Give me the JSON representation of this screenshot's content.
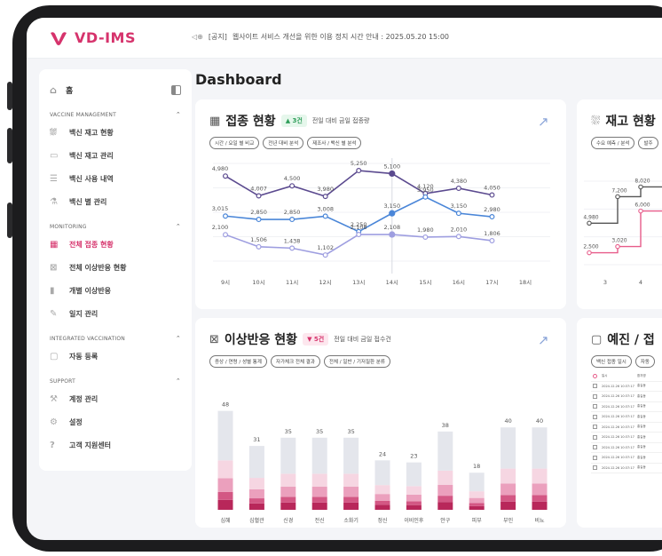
{
  "app": {
    "brand": "VD-IMS"
  },
  "notice": {
    "tag": "[공지]",
    "text": "웹사이트 서비스 개선을 위한 이용 정지 시간 안내 : 2025.05.20 15:00"
  },
  "sidebar": {
    "home": "홈",
    "sections": [
      {
        "title": "VACCINE MANAGEMENT",
        "items": [
          {
            "label": "백신 재고 현황",
            "icon": "chart-area-icon"
          },
          {
            "label": "백신 재고 관리",
            "icon": "box-icon"
          },
          {
            "label": "백신 사용 내역",
            "icon": "list-icon"
          },
          {
            "label": "백신 별 관리",
            "icon": "vial-icon"
          }
        ]
      },
      {
        "title": "MONITORING",
        "items": [
          {
            "label": "전체 접종 현황",
            "icon": "chart-box-icon",
            "active": true
          },
          {
            "label": "전체 이상반응 현황",
            "icon": "alert-chart-icon"
          },
          {
            "label": "개별 이상반응",
            "icon": "bar-icon"
          },
          {
            "label": "일지 관리",
            "icon": "edit-icon"
          }
        ]
      },
      {
        "title": "INTEGRATED VACCINATION",
        "items": [
          {
            "label": "자동 등록",
            "icon": "calendar-icon"
          }
        ]
      },
      {
        "title": "SUPPORT",
        "items": [
          {
            "label": "계정 관리",
            "icon": "wrench-icon"
          },
          {
            "label": "설정",
            "icon": "gear-icon"
          },
          {
            "label": "고객 지원센터",
            "icon": "help-icon"
          }
        ]
      }
    ]
  },
  "page": {
    "title": "Dashboard"
  },
  "cards": {
    "vaccination": {
      "title": "접종 현황",
      "badge": "▲ 3건",
      "subtitle": "전일 대비 금일 접종량",
      "chips": [
        "시간 / 요일 별 비교",
        "전년 대비 분석",
        "제조사 / 백신 별 분석"
      ]
    },
    "stock": {
      "title": "재고 현황",
      "chips": [
        "수요 예측 / 분석",
        "발주"
      ]
    },
    "adverse": {
      "title": "이상반응 현황",
      "badge": "▼ 5건",
      "subtitle": "전일 대비 금일 접수건",
      "chips": [
        "증상 / 연령 / 성별 통계",
        "자가체크 전체 결과",
        "전체 / 일반 / 기저질환 분류"
      ]
    },
    "reservation": {
      "title": "예진 / 접",
      "chips": [
        "백신 접종 일시",
        "자동"
      ],
      "table_headers": [
        "일시",
        "환자명"
      ],
      "rows": [
        [
          "2024.12.26 10:37:17",
          "홍길동"
        ],
        [
          "2024.12.26 10:37:17",
          "홍길동"
        ],
        [
          "2024.12.26 10:37:17",
          "홍길동"
        ],
        [
          "2024.12.26 10:37:17",
          "홍길동"
        ],
        [
          "2024.12.26 10:37:17",
          "홍길동"
        ],
        [
          "2024.12.26 10:37:17",
          "홍길동"
        ],
        [
          "2024.12.26 10:37:17",
          "홍길동"
        ],
        [
          "2024.12.26 10:37:17",
          "홍길동"
        ],
        [
          "2024.12.26 10:37:17",
          "홍길동"
        ]
      ]
    }
  },
  "chart_data": [
    {
      "type": "line",
      "categories": [
        "9시",
        "10시",
        "11시",
        "12시",
        "13시",
        "14시",
        "15시",
        "16시",
        "17시",
        "18시"
      ],
      "series": [
        {
          "values": [
            4980,
            4007,
            4500,
            3980,
            5250,
            5100,
            4120,
            4380,
            4050,
            null
          ],
          "color": "#5b4a8f"
        },
        {
          "values": [
            3015,
            2850,
            2850,
            3008,
            2250,
            3150,
            3950,
            3150,
            2980,
            null
          ],
          "color": "#4a86d8"
        },
        {
          "values": [
            2100,
            1506,
            1438,
            1102,
            2108,
            2108,
            1980,
            2010,
            1806,
            null
          ],
          "color": "#9e9ee0"
        }
      ],
      "highlight_index": 5
    },
    {
      "type": "line",
      "categories": [
        "3",
        "4"
      ],
      "series": [
        {
          "values": [
            4980,
            7200,
            8020
          ],
          "color": "#555"
        },
        {
          "values": [
            2500,
            3020,
            6000
          ],
          "color": "#e75c8a"
        }
      ]
    },
    {
      "type": "bar",
      "categories": [
        "심혜",
        "심혈관",
        "신경",
        "전신",
        "소화기",
        "정신",
        "이비인후",
        "안구",
        "피부",
        "부인",
        "비뇨"
      ],
      "values": [
        48,
        31,
        35,
        35,
        35,
        24,
        23,
        38,
        18,
        40,
        40
      ],
      "ylim": [
        0,
        50
      ]
    }
  ]
}
